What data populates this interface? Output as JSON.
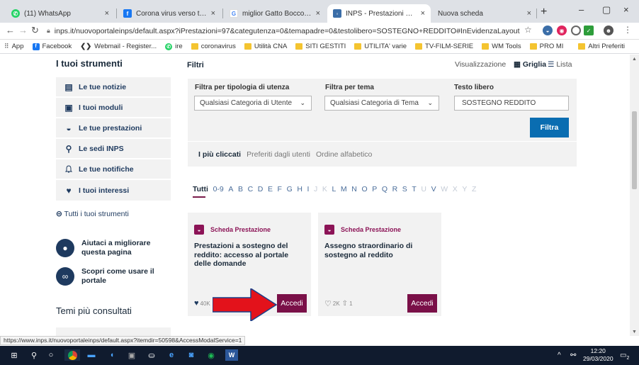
{
  "browser": {
    "tabs": [
      {
        "title": "(11) WhatsApp",
        "close": "×",
        "active": false,
        "fav_color": "#25d366",
        "icon": "whatsapp-icon"
      },
      {
        "title": "Corona virus verso terremoto...",
        "close": "×",
        "active": false,
        "fav_color": "#1877f2",
        "icon": "facebook-icon"
      },
      {
        "title": "miglior Gatto Bocconcini Pollo",
        "close": "×",
        "active": false,
        "fav_color": "#4285f4",
        "icon": "google-icon"
      },
      {
        "title": "INPS - Prestazioni e Servizi - Ti",
        "close": "×",
        "active": true,
        "fav_color": "#3b6ea8",
        "icon": "inps-icon"
      },
      {
        "title": "Nuova scheda",
        "close": "×",
        "active": false,
        "fav_color": "",
        "icon": ""
      }
    ],
    "new_tab": "+",
    "window_controls": [
      "–",
      "▢",
      "×"
    ],
    "url": "inps.it/nuovoportaleinps/default.aspx?iPrestazioni=97&categutenza=0&temapadre=0&testolibero=SOSTEGNO+REDDITO#InEvidenzaLayout",
    "bookmarks": [
      {
        "label": "App",
        "kind": "apps"
      },
      {
        "label": "Facebook",
        "kind": "facebook"
      },
      {
        "label": "Webmail - Register...",
        "kind": "code"
      },
      {
        "label": "ire",
        "kind": "whatsapp"
      },
      {
        "label": "coronavirus",
        "kind": "folder"
      },
      {
        "label": "Utilità CNA",
        "kind": "folder"
      },
      {
        "label": "SITI GESTITI",
        "kind": "folder"
      },
      {
        "label": "UTILITA' varie",
        "kind": "folder"
      },
      {
        "label": "TV-FILM-SERIE",
        "kind": "folder"
      },
      {
        "label": "WM Tools",
        "kind": "folder"
      },
      {
        "label": "PRO MI",
        "kind": "folder"
      }
    ],
    "other_bookmarks": "Altri Preferiti",
    "status_url": "https://www.inps.it/nuovoportaleinps/default.aspx?itemdir=50598&AccessModalService=1"
  },
  "sidebar": {
    "heading": "I tuoi strumenti",
    "items": [
      {
        "label": "Le tue notizie",
        "icon": "newspaper-icon",
        "glyph": "▤"
      },
      {
        "label": "I tuoi moduli",
        "icon": "document-icon",
        "glyph": "▣"
      },
      {
        "label": "Le tue prestazioni",
        "icon": "briefcase-icon",
        "glyph": "◒"
      },
      {
        "label": "Le sedi INPS",
        "icon": "location-pin-icon",
        "glyph": "⚲"
      },
      {
        "label": "Le tue notifiche",
        "icon": "bell-icon",
        "glyph": "♫"
      },
      {
        "label": "I tuoi interessi",
        "icon": "heart-icon",
        "glyph": "♥"
      }
    ],
    "all_tools": "Tutti i tuoi strumenti",
    "help1": "Aiutaci a migliorare questa pagina",
    "help2": "Scopri come usare il portale",
    "temi": "Temi più consultati"
  },
  "filters": {
    "title": "Filtri",
    "view_label": "Visualizzazione",
    "grid_label": "Griglia",
    "list_label": "Lista",
    "user_type_label": "Filtra per tipologia di utenza",
    "user_type_value": "Qualsiasi Categoria di Utente",
    "theme_label": "Filtra per tema",
    "theme_value": "Qualsiasi Categoria di Tema",
    "free_text_label": "Testo libero",
    "free_text_value": "SOSTEGNO REDDITO",
    "submit": "Filtra"
  },
  "sort_tabs": [
    "I più cliccati",
    "Preferiti dagli utenti",
    "Ordine alfabetico"
  ],
  "alphabet": [
    {
      "l": "Tutti",
      "s": "on"
    },
    {
      "l": "0-9",
      "s": ""
    },
    {
      "l": "A",
      "s": ""
    },
    {
      "l": "B",
      "s": ""
    },
    {
      "l": "C",
      "s": ""
    },
    {
      "l": "D",
      "s": ""
    },
    {
      "l": "E",
      "s": ""
    },
    {
      "l": "F",
      "s": ""
    },
    {
      "l": "G",
      "s": ""
    },
    {
      "l": "H",
      "s": ""
    },
    {
      "l": "I",
      "s": ""
    },
    {
      "l": "J",
      "s": "dim"
    },
    {
      "l": "K",
      "s": "dim"
    },
    {
      "l": "L",
      "s": ""
    },
    {
      "l": "M",
      "s": ""
    },
    {
      "l": "N",
      "s": ""
    },
    {
      "l": "O",
      "s": ""
    },
    {
      "l": "P",
      "s": ""
    },
    {
      "l": "Q",
      "s": ""
    },
    {
      "l": "R",
      "s": ""
    },
    {
      "l": "S",
      "s": ""
    },
    {
      "l": "T",
      "s": ""
    },
    {
      "l": "U",
      "s": "dim"
    },
    {
      "l": "V",
      "s": ""
    },
    {
      "l": "W",
      "s": "dim"
    },
    {
      "l": "X",
      "s": "dim"
    },
    {
      "l": "Y",
      "s": "dim"
    },
    {
      "l": "Z",
      "s": "dim"
    }
  ],
  "cards": [
    {
      "kind": "Scheda Prestazione",
      "title": "Prestazioni a sostegno del reddito: accesso al portale delle domande",
      "likes": "40K",
      "shares": "",
      "button": "Accedi"
    },
    {
      "kind": "Scheda Prestazione",
      "title": "Assegno straordinario di sostegno al reddito",
      "likes": "2K",
      "shares": "1",
      "button": "Accedi"
    }
  ],
  "taskbar": {
    "time": "12:20",
    "date": "29/03/2020",
    "notifications": "2"
  },
  "colors": {
    "accent": "#7a1048",
    "brand_blue": "#0a6db1",
    "navy": "#1e3a5f",
    "panel": "#f2f2f2",
    "arrow_red": "#e3121b"
  }
}
